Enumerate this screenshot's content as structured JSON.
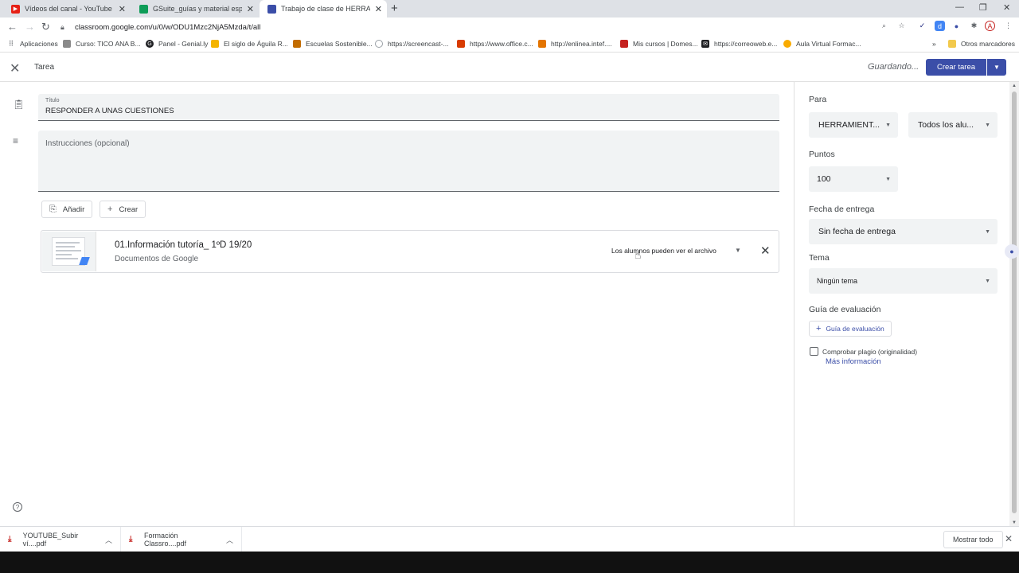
{
  "browser": {
    "tabs": [
      {
        "title": "Vídeos del canal - YouTube Studio",
        "favicon_color": "#e62117"
      },
      {
        "title": "GSuite_guías y material específico",
        "favicon_color": "#0f9d58"
      },
      {
        "title": "Trabajo de clase de HERRAMIENTAS",
        "favicon_color": "#3b4ea8"
      }
    ],
    "url": "classroom.google.com/u/0/w/ODU1Mzc2NjA5Mzda/t/all",
    "bookmarks": [
      {
        "label": "Aplicaciones",
        "color": "#5f6368"
      },
      {
        "label": "Curso: TICO ANA B...",
        "color": "#8a8a8a"
      },
      {
        "label": "Panel - Genial.ly",
        "color": "#202124"
      },
      {
        "label": "El siglo de Águila R...",
        "color": "#f4b400"
      },
      {
        "label": "Escuelas Sostenible...",
        "color": "#c26c00"
      },
      {
        "label": "https://screencast-...",
        "color": "#9aa0a6"
      },
      {
        "label": "https://www.office.c...",
        "color": "#d83b01"
      },
      {
        "label": "http://enlinea.intef....",
        "color": "#e37400"
      },
      {
        "label": "Mis cursos | Domes...",
        "color": "#c5221f"
      },
      {
        "label": "https://correoweb.e...",
        "color": "#202124"
      },
      {
        "label": "Aula Virtual Formac...",
        "color": "#f9ab00"
      }
    ],
    "more_bookmarks": "»",
    "other_bookmarks": "Otros marcadores"
  },
  "app": {
    "title": "Tarea",
    "saving_status": "Guardando...",
    "create_button": "Crear tarea"
  },
  "form": {
    "title_label": "Título",
    "title_value": "RESPONDER A UNAS CUESTIONES",
    "instructions_placeholder": "Instrucciones (opcional)",
    "add_button": "Añadir",
    "create_button": "Crear",
    "attachment": {
      "name": "01.Información tutoría_ 1ºD 19/20",
      "type": "Documentos de Google",
      "permission": "Los alumnos pueden ver el archivo"
    }
  },
  "sidebar": {
    "for_label": "Para",
    "class_value": "HERRAMIENT...",
    "students_value": "Todos los alu...",
    "points_label": "Puntos",
    "points_value": "100",
    "due_label": "Fecha de entrega",
    "due_value": "Sin fecha de entrega",
    "topic_label": "Tema",
    "topic_value": "Ningún tema",
    "rubric_label": "Guía de evaluación",
    "rubric_button": "Guía de evaluación",
    "plagiarism_label": "Comprobar plagio (originalidad)",
    "more_info": "Más información"
  },
  "downloads": {
    "items": [
      "YOUTUBE_Subir ví....pdf",
      "Formación Classro....pdf"
    ],
    "show_all": "Mostrar todo"
  }
}
